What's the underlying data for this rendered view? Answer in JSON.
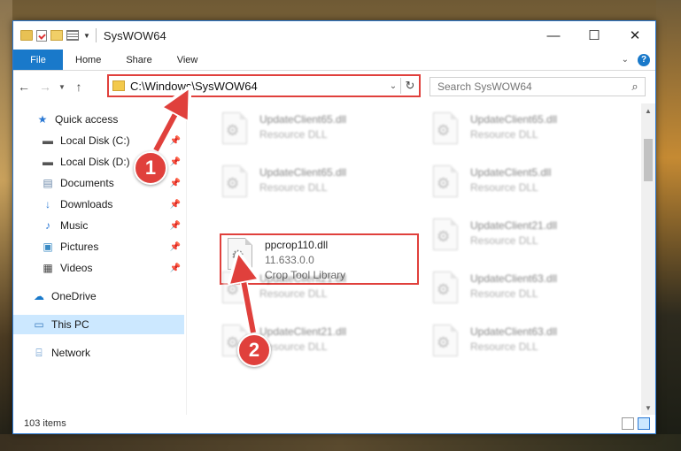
{
  "window": {
    "title": "SysWOW64",
    "controls": {
      "minimize": "—",
      "maximize": "☐",
      "close": "✕"
    }
  },
  "ribbon": {
    "tabs": [
      "File",
      "Home",
      "Share",
      "View"
    ],
    "help": "?"
  },
  "navbar": {
    "address": "C:\\Windows\\SysWOW64",
    "search_placeholder": "Search SysWOW64"
  },
  "sidebar": {
    "items": [
      {
        "label": "Quick access",
        "icon": "star-icon",
        "pinned": false
      },
      {
        "label": "Local Disk (C:)",
        "icon": "drive-icon",
        "pinned": true
      },
      {
        "label": "Local Disk (D:)",
        "icon": "drive-icon",
        "pinned": true
      },
      {
        "label": "Documents",
        "icon": "documents-icon",
        "pinned": true
      },
      {
        "label": "Downloads",
        "icon": "downloads-icon",
        "pinned": true
      },
      {
        "label": "Music",
        "icon": "music-icon",
        "pinned": true
      },
      {
        "label": "Pictures",
        "icon": "pictures-icon",
        "pinned": true
      },
      {
        "label": "Videos",
        "icon": "videos-icon",
        "pinned": true
      },
      {
        "label": "OneDrive",
        "icon": "cloud-icon",
        "pinned": false
      },
      {
        "label": "This PC",
        "icon": "computer-icon",
        "pinned": false
      },
      {
        "label": "Network",
        "icon": "network-icon",
        "pinned": false
      }
    ]
  },
  "files": [
    {
      "name": "UpdateClient65.dll",
      "type": "Resource DLL"
    },
    {
      "name": "UpdateClient65.dll",
      "type": "Resource DLL"
    },
    {
      "name": "UpdateClient65.dll",
      "type": "Resource DLL"
    },
    {
      "name": "UpdateClient5.dll",
      "type": "Resource DLL"
    },
    {
      "name": "ppcrop110.dll",
      "version": "11.633.0.0",
      "type": "Crop Tool Library"
    },
    {
      "name": "UpdateClient21.dll",
      "type": "Resource DLL"
    },
    {
      "name": "UpdateClient21.dll",
      "type": "Resource DLL"
    },
    {
      "name": "UpdateClient63.dll",
      "type": "Resource DLL"
    },
    {
      "name": "UpdateClient21.dll",
      "type": "Resource DLL"
    },
    {
      "name": "UpdateClient63.dll",
      "type": "Resource DLL"
    }
  ],
  "status": {
    "item_count": "103 items"
  },
  "annotations": {
    "step1": "1",
    "step2": "2"
  },
  "colors": {
    "accent": "#1979ca",
    "highlight": "#e0403c",
    "selected_bg": "#cce8ff"
  }
}
